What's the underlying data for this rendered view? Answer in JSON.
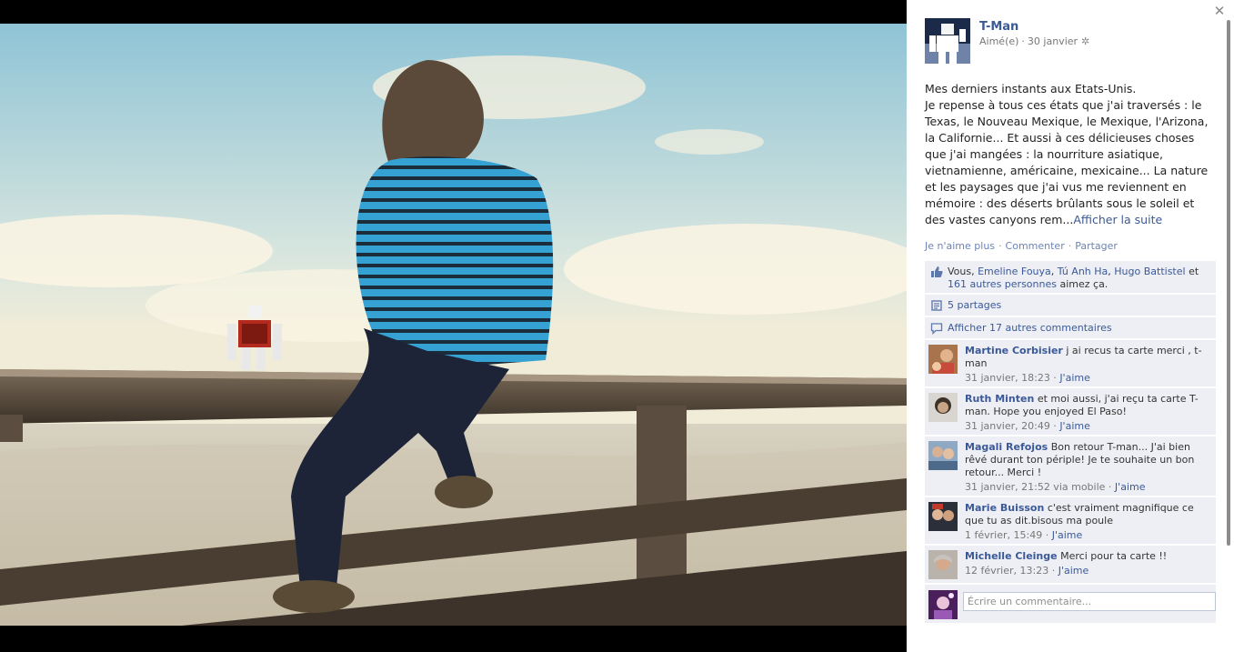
{
  "photo": {
    "alt_icon": "photo-image"
  },
  "close": {
    "glyph": "✕"
  },
  "post": {
    "author": "T-Man",
    "liked_label": "Aimé(e)",
    "date": "30 janvier",
    "caption_lines": [
      "Mes derniers instants aux Etats-Unis.",
      "Je repense à tous ces états que j'ai traversés : le Texas, le Nouveau Mexique, le Mexique, l'Arizona, la Californie... Et aussi à ces délicieuses choses que j'ai mangées : la nourriture asiatique, vietnamienne, américaine, mexicaine... La nature et les paysages que j'ai vus me reviennent en mémoire : des déserts brûlants sous le soleil et des vastes canyons rem..."
    ],
    "see_more": "Afficher la suite"
  },
  "actions": {
    "unlike": "Je n'aime plus",
    "comment": "Commenter",
    "share": "Partager",
    "separator": "·"
  },
  "likes": {
    "you": "Vous,",
    "people": [
      "Emeline Fouya",
      "Tú Anh Ha",
      "Hugo Battistel"
    ],
    "and": "et",
    "others": "161 autres personnes",
    "suffix": "aimez ça."
  },
  "shares": {
    "label": "5 partages"
  },
  "more_comments": {
    "label": "Afficher 17 autres commentaires"
  },
  "comments": [
    {
      "name": "Martine Corbisier",
      "text": "j ai recus ta carte merci , t-man",
      "time": "31 janvier, 18:23",
      "like": "J'aime"
    },
    {
      "name": "Ruth Minten",
      "text": "et moi aussi, j'ai reçu ta carte T-man. Hope you enjoyed El Paso!",
      "time": "31 janvier, 20:49",
      "like": "J'aime"
    },
    {
      "name": "Magali Refojos",
      "text": "Bon retour T-man... J'ai bien rêvé durant ton périple! Je te souhaite un bon retour... Merci !",
      "time": "31 janvier, 21:52 via mobile",
      "like": "J'aime"
    },
    {
      "name": "Marie Buisson",
      "text": "c'est vraiment magnifique ce que tu as dit.bisous ma poule",
      "time": "1 février, 15:49",
      "like": "J'aime"
    },
    {
      "name": "Michelle Cleinge",
      "text": "Merci pour ta carte !!",
      "time": "12 février, 13:23",
      "like": "J'aime"
    }
  ],
  "compose": {
    "placeholder": "Écrire un commentaire..."
  },
  "colors": {
    "link": "#3b5998",
    "ufi_bg": "#edeff4",
    "stage": "#000000"
  }
}
